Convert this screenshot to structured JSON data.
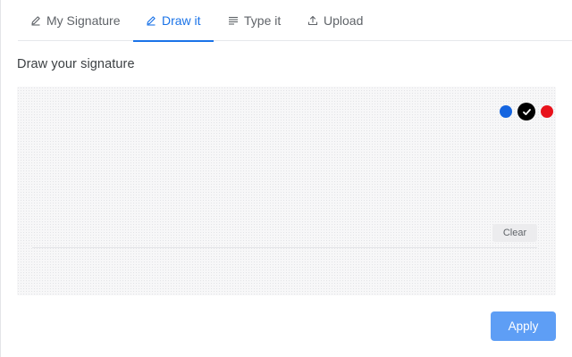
{
  "tabs": {
    "my_signature": "My Signature",
    "draw_it": "Draw it",
    "type_it": "Type it",
    "upload": "Upload",
    "active": "draw_it"
  },
  "heading": "Draw your signature",
  "pen_colors": {
    "options": [
      {
        "name": "blue",
        "hex": "#1565e0"
      },
      {
        "name": "black",
        "hex": "#000000"
      },
      {
        "name": "red",
        "hex": "#e8121b"
      }
    ],
    "selected": "black"
  },
  "buttons": {
    "clear": "Clear",
    "apply": "Apply"
  },
  "icons": {
    "my_signature": "pen-icon",
    "draw_it": "pen-icon",
    "type_it": "text-lines-icon",
    "upload": "upload-icon",
    "selected_color": "checkmark-icon"
  }
}
